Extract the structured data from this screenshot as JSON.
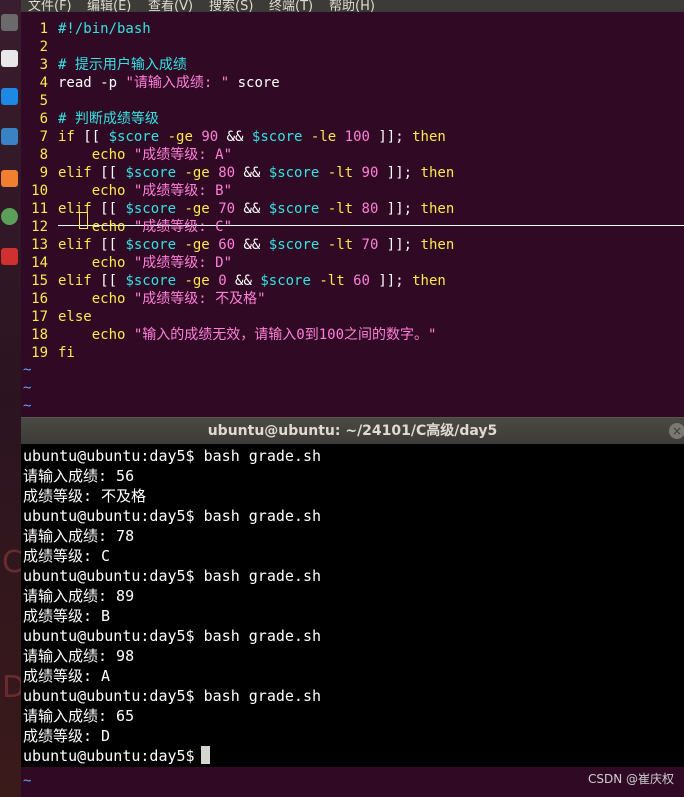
{
  "menubar": {
    "items": [
      "文件(F)",
      "编辑(E)",
      "查看(V)",
      "搜索(S)",
      "终端(T)",
      "帮助(H)"
    ]
  },
  "editor": {
    "lines": [
      {
        "n": "1",
        "tokens": [
          [
            "cmt",
            "#!/bin/bash"
          ]
        ]
      },
      {
        "n": "2",
        "tokens": []
      },
      {
        "n": "3",
        "tokens": [
          [
            "cmt",
            "# 提示用户输入成绩"
          ]
        ]
      },
      {
        "n": "4",
        "tokens": [
          [
            "plain",
            "read -p "
          ],
          [
            "str",
            "\"请输入成绩: \""
          ],
          [
            "plain",
            " score"
          ]
        ]
      },
      {
        "n": "5",
        "tokens": []
      },
      {
        "n": "6",
        "tokens": [
          [
            "cmt",
            "# 判断成绩等级"
          ]
        ]
      },
      {
        "n": "7",
        "tokens": [
          [
            "kw",
            "if"
          ],
          [
            "plain",
            " [[ "
          ],
          [
            "var",
            "$score"
          ],
          [
            "plain",
            " "
          ],
          [
            "op",
            "-ge"
          ],
          [
            "plain",
            " "
          ],
          [
            "num",
            "90"
          ],
          [
            "plain",
            " && "
          ],
          [
            "var",
            "$score"
          ],
          [
            "plain",
            " "
          ],
          [
            "op",
            "-le"
          ],
          [
            "plain",
            " "
          ],
          [
            "num",
            "100"
          ],
          [
            "plain",
            " ]]; "
          ],
          [
            "kw",
            "then"
          ]
        ]
      },
      {
        "n": "8",
        "tokens": [
          [
            "plain",
            "    "
          ],
          [
            "kw",
            "echo"
          ],
          [
            "plain",
            " "
          ],
          [
            "str",
            "\"成绩等级: A\""
          ]
        ]
      },
      {
        "n": "9",
        "tokens": [
          [
            "kw",
            "elif"
          ],
          [
            "plain",
            " [[ "
          ],
          [
            "var",
            "$score"
          ],
          [
            "plain",
            " "
          ],
          [
            "op",
            "-ge"
          ],
          [
            "plain",
            " "
          ],
          [
            "num",
            "80"
          ],
          [
            "plain",
            " && "
          ],
          [
            "var",
            "$score"
          ],
          [
            "plain",
            " "
          ],
          [
            "op",
            "-lt"
          ],
          [
            "plain",
            " "
          ],
          [
            "num",
            "90"
          ],
          [
            "plain",
            " ]]; "
          ],
          [
            "kw",
            "then"
          ]
        ]
      },
      {
        "n": "10",
        "tokens": [
          [
            "plain",
            "    "
          ],
          [
            "kw",
            "echo"
          ],
          [
            "plain",
            " "
          ],
          [
            "str",
            "\"成绩等级: B\""
          ]
        ]
      },
      {
        "n": "11",
        "tokens": [
          [
            "kw",
            "elif"
          ],
          [
            "plain",
            " [[ "
          ],
          [
            "var",
            "$score"
          ],
          [
            "plain",
            " "
          ],
          [
            "op",
            "-ge"
          ],
          [
            "plain",
            " "
          ],
          [
            "num",
            "70"
          ],
          [
            "plain",
            " && "
          ],
          [
            "var",
            "$score"
          ],
          [
            "plain",
            " "
          ],
          [
            "op",
            "-lt"
          ],
          [
            "plain",
            " "
          ],
          [
            "num",
            "80"
          ],
          [
            "plain",
            " ]]; "
          ],
          [
            "kw",
            "then"
          ]
        ]
      },
      {
        "n": "12",
        "tokens": [
          [
            "plain",
            "    "
          ],
          [
            "kw",
            "echo"
          ],
          [
            "plain",
            " "
          ],
          [
            "str",
            "\"成绩等级: C\""
          ]
        ]
      },
      {
        "n": "13",
        "tokens": [
          [
            "kw",
            "elif"
          ],
          [
            "plain",
            " [[ "
          ],
          [
            "var",
            "$score"
          ],
          [
            "plain",
            " "
          ],
          [
            "op",
            "-ge"
          ],
          [
            "plain",
            " "
          ],
          [
            "num",
            "60"
          ],
          [
            "plain",
            " && "
          ],
          [
            "var",
            "$score"
          ],
          [
            "plain",
            " "
          ],
          [
            "op",
            "-lt"
          ],
          [
            "plain",
            " "
          ],
          [
            "num",
            "70"
          ],
          [
            "plain",
            " ]]; "
          ],
          [
            "kw",
            "then"
          ]
        ]
      },
      {
        "n": "14",
        "tokens": [
          [
            "plain",
            "    "
          ],
          [
            "kw",
            "echo"
          ],
          [
            "plain",
            " "
          ],
          [
            "str",
            "\"成绩等级: D\""
          ]
        ]
      },
      {
        "n": "15",
        "tokens": [
          [
            "kw",
            "elif"
          ],
          [
            "plain",
            " [[ "
          ],
          [
            "var",
            "$score"
          ],
          [
            "plain",
            " "
          ],
          [
            "op",
            "-ge"
          ],
          [
            "plain",
            " "
          ],
          [
            "num",
            "0"
          ],
          [
            "plain",
            " && "
          ],
          [
            "var",
            "$score"
          ],
          [
            "plain",
            " "
          ],
          [
            "op",
            "-lt"
          ],
          [
            "plain",
            " "
          ],
          [
            "num",
            "60"
          ],
          [
            "plain",
            " ]]; "
          ],
          [
            "kw",
            "then"
          ]
        ]
      },
      {
        "n": "16",
        "tokens": [
          [
            "plain",
            "    "
          ],
          [
            "kw",
            "echo"
          ],
          [
            "plain",
            " "
          ],
          [
            "str",
            "\"成绩等级: 不及格\""
          ]
        ]
      },
      {
        "n": "17",
        "tokens": [
          [
            "kw",
            "else"
          ]
        ]
      },
      {
        "n": "18",
        "tokens": [
          [
            "plain",
            "    "
          ],
          [
            "kw",
            "echo"
          ],
          [
            "plain",
            " "
          ],
          [
            "str",
            "\"输入的成绩无效，请输入0到100之间的数字。\""
          ]
        ]
      },
      {
        "n": "19",
        "tokens": [
          [
            "kw",
            "fi"
          ]
        ]
      }
    ],
    "empty_marker": "~"
  },
  "terminal": {
    "title": "ubuntu@ubuntu: ~/24101/C高级/day5",
    "close_glyph": "×",
    "lines": [
      "ubuntu@ubuntu:day5$ bash grade.sh",
      "请输入成绩: 56",
      "成绩等级: 不及格",
      "ubuntu@ubuntu:day5$ bash grade.sh",
      "请输入成绩: 78",
      "成绩等级: C",
      "ubuntu@ubuntu:day5$ bash grade.sh",
      "请输入成绩: 89",
      "成绩等级: B",
      "ubuntu@ubuntu:day5$ bash grade.sh",
      "请输入成绩: 98",
      "成绩等级: A",
      "ubuntu@ubuntu:day5$ bash grade.sh",
      "请输入成绩: 65",
      "成绩等级: D",
      "ubuntu@ubuntu:day5$"
    ]
  },
  "launcher": {
    "icons": [
      "terminal-icon",
      "files-icon",
      "vscode-icon",
      "cpp-icon",
      "software-icon",
      "network-icon",
      "presentation-icon"
    ]
  },
  "watermark": "CSDN @崔庆权"
}
